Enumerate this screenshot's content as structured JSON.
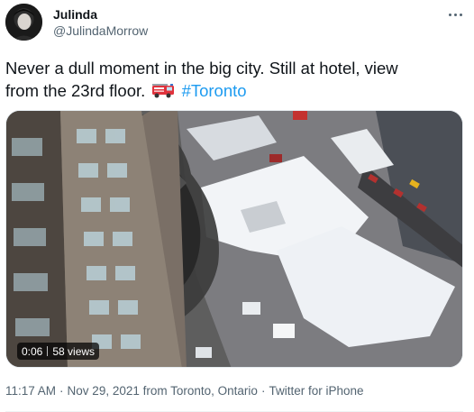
{
  "author": {
    "display_name": "Julinda",
    "handle": "@JulindaMorrow"
  },
  "tweet": {
    "text_line1": "Never a dull moment in the big city. Still at hotel, view",
    "text_line2": "from the 23rd floor.",
    "emoji_icon": "fire-engine-icon",
    "hashtag": "#Toronto"
  },
  "media": {
    "duration": "0:06",
    "views": "58 views"
  },
  "meta": {
    "time": "11:17 AM",
    "date": "Nov 29, 2021",
    "location": "from Toronto, Ontario",
    "source": "Twitter for iPhone",
    "separator": "·"
  },
  "colors": {
    "link": "#1d9bf0",
    "secondary_text": "#536471",
    "primary_text": "#0f1419"
  }
}
